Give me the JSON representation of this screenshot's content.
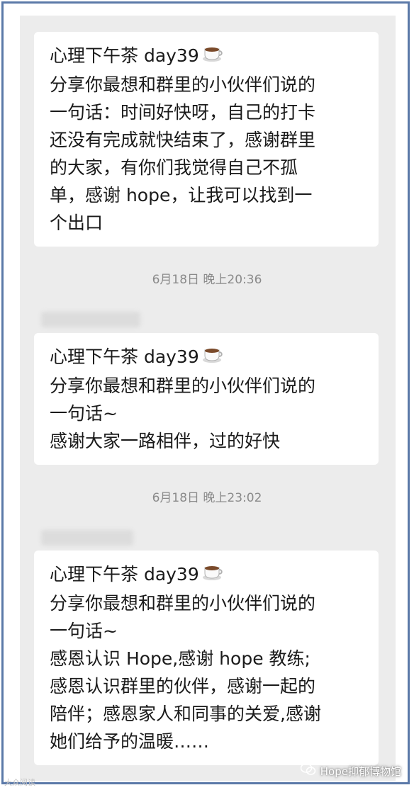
{
  "messages": [
    {
      "lines": [
        "心理下午茶 day39",
        "分享你最想和群里的小伙伴们说的",
        "一句话：时间好快呀，自己的打卡",
        "还没有完成就快结束了，感谢群里",
        "的大家，有你们我觉得自己不孤",
        "单，感谢 hope，让我可以找到一",
        "个出口"
      ],
      "icon": "coffee-cup-icon"
    },
    {
      "lines": [
        "心理下午茶 day39",
        "分享你最想和群里的小伙伴们说的",
        "一句话~",
        "感谢大家一路相伴，过的好快"
      ],
      "icon": "coffee-cup-icon"
    },
    {
      "lines": [
        "心理下午茶 day39",
        "分享你最想和群里的小伙伴们说的",
        "一句话~",
        "感恩认识 Hope,感谢 hope 教练;",
        "感恩认识群里的伙伴，感谢一起的",
        "陪伴；感恩家人和同事的关爱,感谢",
        "她们给予的温暖……"
      ],
      "icon": "coffee-cup-icon"
    }
  ],
  "timestamps": [
    "6月18日 晚上20:36",
    "6月18日 晚上23:02"
  ],
  "watermarks": {
    "left": "大众阅读",
    "right": "Hope抑郁博物馆"
  },
  "colors": {
    "frame_border": "#5b79a8",
    "chat_background": "#ececec",
    "bubble": "#ffffff",
    "timestamp_text": "#8a8a8a"
  }
}
